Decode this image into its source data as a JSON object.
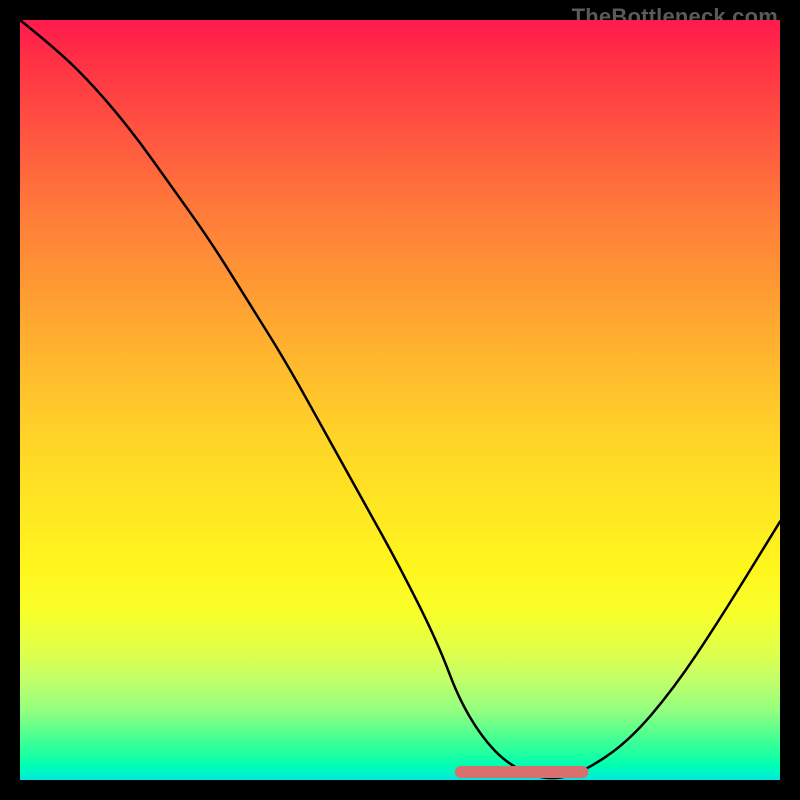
{
  "watermark": "TheBottleneck.com",
  "chart_data": {
    "type": "line",
    "title": "",
    "xlabel": "",
    "ylabel": "",
    "xlim": [
      0,
      100
    ],
    "ylim": [
      0,
      100
    ],
    "grid": false,
    "series": [
      {
        "name": "curve",
        "color": "#000000",
        "x": [
          0,
          5,
          10,
          15,
          20,
          25,
          30,
          35,
          40,
          45,
          50,
          55,
          58,
          62,
          66,
          70,
          74,
          80,
          86,
          92,
          100
        ],
        "values": [
          100,
          96,
          91,
          85,
          78,
          71,
          63,
          55,
          46,
          37,
          28,
          18,
          10,
          4,
          1,
          0,
          1,
          5,
          12,
          21,
          34
        ]
      }
    ],
    "annotations": [
      {
        "name": "optimum-marker",
        "shape": "rounded-segment",
        "color": "#d87070",
        "x_start": 58,
        "x_end": 74,
        "y": 0,
        "stroke_width": 12
      }
    ],
    "background_gradient": {
      "type": "vertical",
      "stops": [
        {
          "pos": 0.0,
          "color": "#ff1a4d"
        },
        {
          "pos": 0.25,
          "color": "#ff7a3a"
        },
        {
          "pos": 0.55,
          "color": "#ffd428"
        },
        {
          "pos": 0.78,
          "color": "#e0ff4a"
        },
        {
          "pos": 1.0,
          "color": "#00e8e0"
        }
      ]
    }
  }
}
